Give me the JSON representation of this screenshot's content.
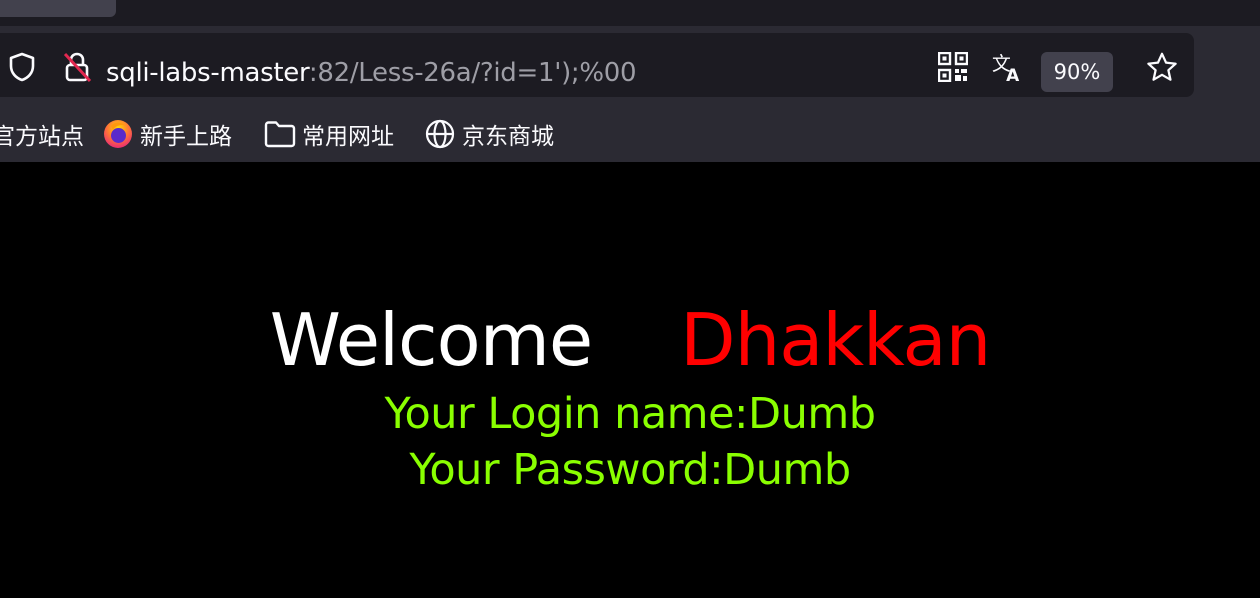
{
  "browser": {
    "url_host": "sqli-labs-master",
    "url_rest": ":82/Less-26a/?id=1');%00",
    "zoom": "90%",
    "icons": [
      "shield-icon",
      "insecure-lock-icon",
      "qr-code-icon",
      "translate-icon",
      "bookmark-star-icon"
    ]
  },
  "bookmarks": [
    {
      "label": "官方站点",
      "icon": "firefox-icon"
    },
    {
      "label": "新手上路",
      "icon": "firefox-icon"
    },
    {
      "label": "常用网址",
      "icon": "folder-icon"
    },
    {
      "label": "京东商城",
      "icon": "globe-icon"
    }
  ],
  "page": {
    "welcome": "Welcome",
    "name": "Dhakkan",
    "login_line": "Your Login name:Dumb",
    "password_line": "Your Password:Dumb",
    "colors": {
      "background": "#000000",
      "welcome": "#ffffff",
      "name": "#ff0000",
      "info": "#8aff00"
    }
  }
}
